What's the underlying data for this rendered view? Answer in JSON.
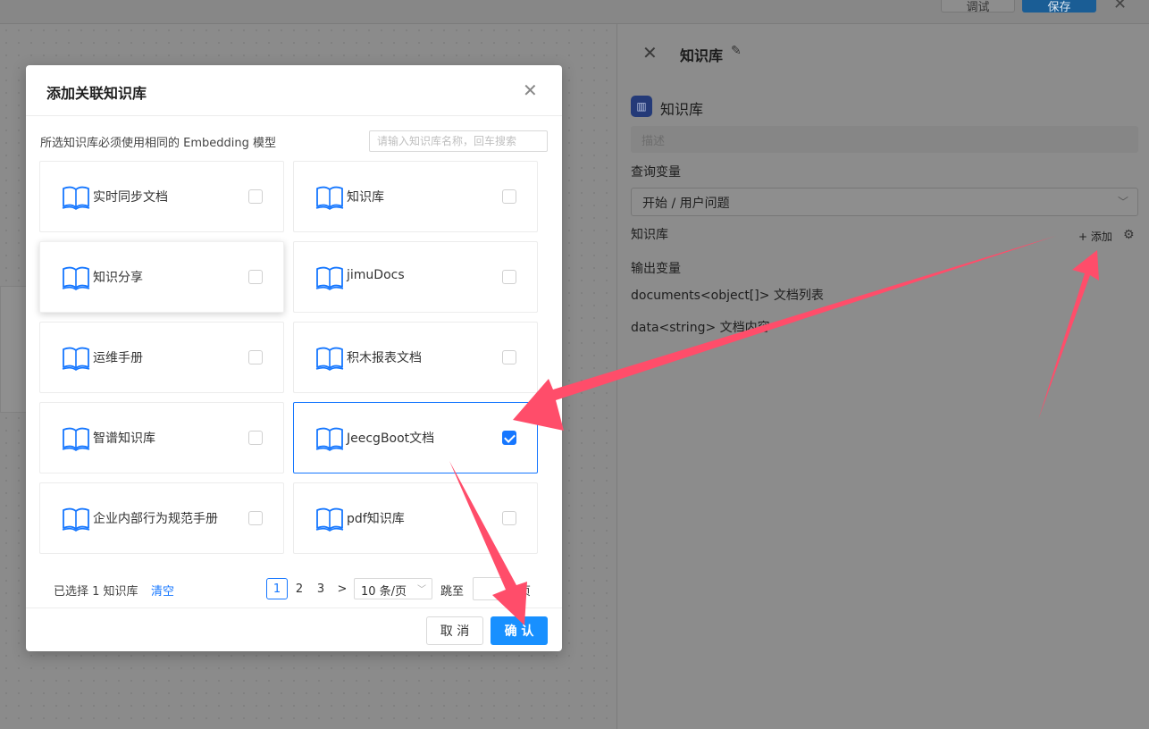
{
  "topbar": {
    "debug_label": "调试",
    "save_label": "保存"
  },
  "right_panel": {
    "title": "知识库",
    "node_name": "知识库",
    "desc_placeholder": "描述",
    "query_label": "查询变量",
    "query_value": "开始 / 用户问题",
    "kb_label": "知识库",
    "add_label": "+ 添加",
    "output_label": "输出变量",
    "output_1": "documents<object[]> 文档列表",
    "output_2": "data<string> 文档内容"
  },
  "modal": {
    "title": "添加关联知识库",
    "hint": "所选知识库必须使用相同的 Embedding 模型",
    "search_placeholder": "请输入知识库名称，回车搜索",
    "items": [
      {
        "name": "实时同步文档",
        "checked": false
      },
      {
        "name": "知识库",
        "checked": false
      },
      {
        "name": "知识分享",
        "checked": false
      },
      {
        "name": "jimuDocs",
        "checked": false
      },
      {
        "name": "运维手册",
        "checked": false
      },
      {
        "name": "积木报表文档",
        "checked": false
      },
      {
        "name": "智谱知识库",
        "checked": false
      },
      {
        "name": "JeecgBoot文档",
        "checked": true
      },
      {
        "name": "企业内部行为规范手册",
        "checked": false
      },
      {
        "name": "pdf知识库",
        "checked": false
      }
    ],
    "selected_info": "已选择 1 知识库",
    "clear_label": "清空",
    "pages": [
      "1",
      "2",
      "3"
    ],
    "next_symbol": ">",
    "page_size": "10 条/页",
    "jump_label": "跳至",
    "jump_unit": "页",
    "cancel_label": "取 消",
    "ok_label": "确 认"
  },
  "colors": {
    "accent": "#1677ff",
    "primary_button": "#1890ff",
    "arrow": "#ff4d6a"
  }
}
